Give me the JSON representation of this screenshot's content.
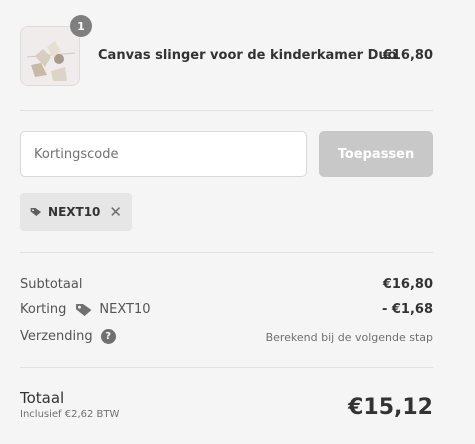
{
  "product": {
    "quantity": "1",
    "name": "Canvas slinger voor de kinderkamer Duo",
    "price": "€16,80"
  },
  "discount": {
    "placeholder": "Kortingscode",
    "apply_label": "Toepassen",
    "applied_code": "NEXT10"
  },
  "summary": {
    "subtotal_label": "Subtotaal",
    "subtotal_value": "€16,80",
    "discount_label": "Korting",
    "discount_code": "NEXT10",
    "discount_value": "- €1,68",
    "shipping_label": "Verzending",
    "shipping_value": "Berekend bij de volgende stap"
  },
  "total": {
    "label": "Totaal",
    "vat_note": "Inclusief €2,62 BTW",
    "value": "€15,12"
  },
  "colors": {
    "background": "#f5f5f5",
    "button_disabled": "#c8c8c8",
    "badge": "#7f7f7f",
    "tag_bg": "#e6e6e6"
  },
  "icons": [
    "tag-icon",
    "close-icon",
    "help-icon"
  ]
}
